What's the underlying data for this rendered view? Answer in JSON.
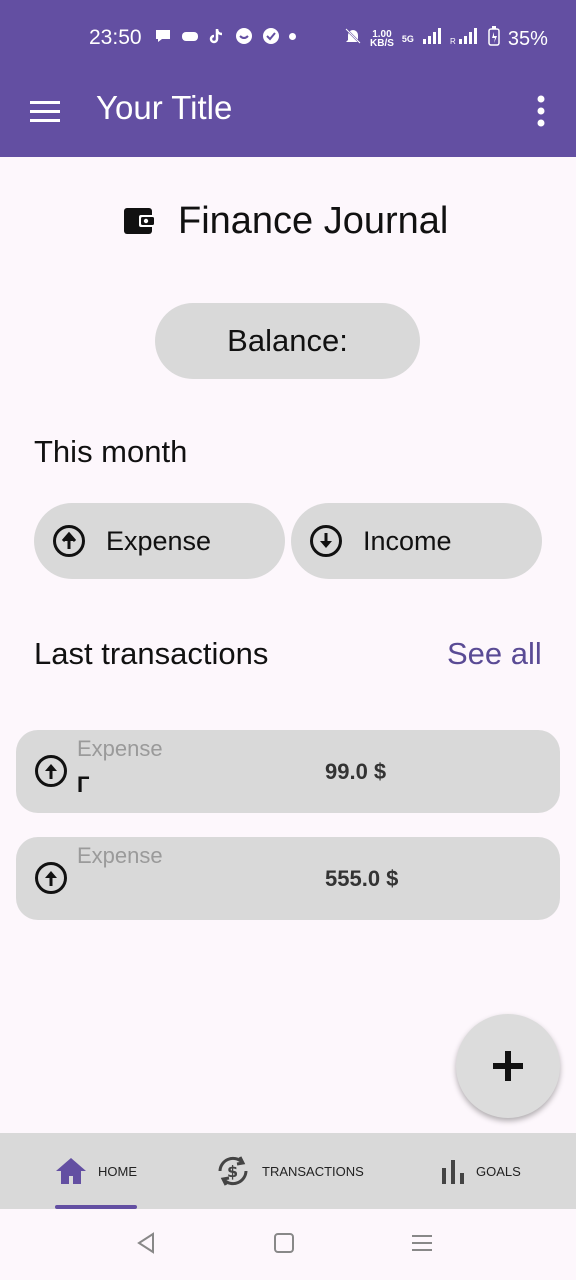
{
  "status_bar": {
    "time": "23:50",
    "net_speed_value": "1.00",
    "net_speed_unit": "KB/S",
    "network_label": "5G",
    "battery": "35%"
  },
  "app_bar": {
    "title": "Your Title"
  },
  "header": {
    "title": "Finance Journal"
  },
  "balance": {
    "label": "Balance:"
  },
  "this_month": {
    "title": "This month",
    "expense_label": "Expense",
    "income_label": "Income"
  },
  "last_transactions": {
    "title": "Last transactions",
    "see_all": "See all",
    "items": [
      {
        "type": "Expense",
        "description": "Г",
        "amount": "99.0 $"
      },
      {
        "type": "Expense",
        "description": "",
        "amount": "555.0 $"
      }
    ]
  },
  "bottom_nav": {
    "items": [
      {
        "label": "HOME"
      },
      {
        "label": "TRANSACTIONS"
      },
      {
        "label": "GOALS"
      }
    ]
  },
  "colors": {
    "primary": "#634fa2",
    "link": "#5a4b95",
    "surface": "#d9d9d9",
    "background": "#fdf7fc"
  }
}
